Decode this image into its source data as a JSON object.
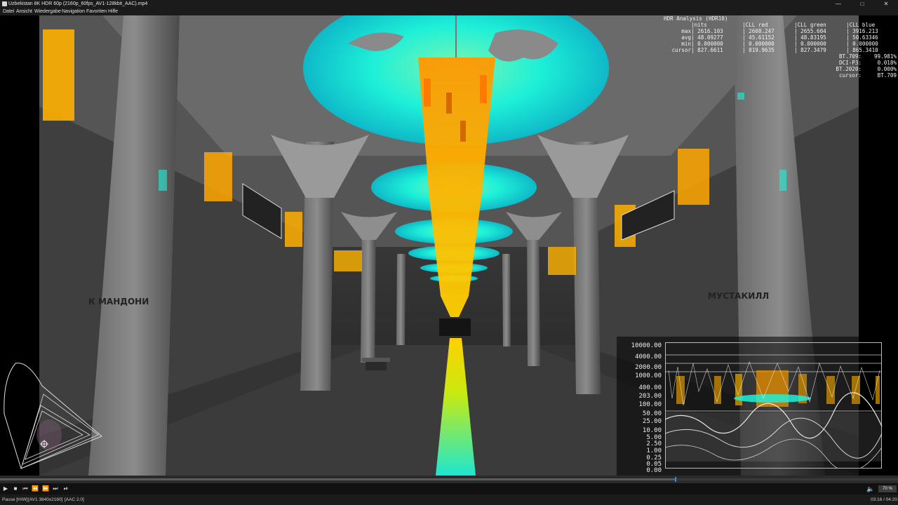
{
  "window": {
    "title": "Uzbekistan 8K HDR 60p (2160p_60fps_AV1-128kbit_AAC).mp4",
    "controls": [
      "—",
      "□",
      "✕"
    ]
  },
  "menu": [
    "Datei",
    "Ansicht",
    "Wiedergabe",
    "Navigation",
    "Favoriten",
    "Hilfe"
  ],
  "hdr_analysis": {
    "title": "HDR Analysis (HDR10)",
    "columns": [
      "nits",
      "CLL red",
      "CLL green",
      "CLL blue"
    ],
    "rows": [
      {
        "label": "max",
        "values": [
          "2616.103",
          "2608.247",
          "2655.604",
          "3916.213"
        ]
      },
      {
        "label": "avg",
        "values": [
          "48.09277",
          "45.61152",
          "48.83195",
          "50.63346"
        ]
      },
      {
        "label": "min",
        "values": [
          "0.000000",
          "0.000000",
          "0.000000",
          "0.000000"
        ]
      },
      {
        "label": "cursor",
        "values": [
          "827.6611",
          "819.9635",
          "827.3479",
          "865.3410"
        ]
      }
    ],
    "gamut": [
      {
        "label": "BT.709:",
        "value": "99.981%"
      },
      {
        "label": "DCI-P3:",
        "value": "0.018%"
      },
      {
        "label": "BT.2020:",
        "value": "0.000%"
      },
      {
        "label": "cursor:",
        "value": "BT.709"
      }
    ]
  },
  "histogram": {
    "scale_labels": [
      "10000.00",
      "4000.00",
      "2000.00",
      "1000.00",
      "400.00",
      "203.00",
      "100.00",
      "50.00",
      "25.00",
      "10.00",
      "5.00",
      "2.50",
      "1.00",
      "0.25",
      "0.05",
      "0.00"
    ]
  },
  "station_signs": {
    "left": "К МАНДОНИ",
    "right": "МУСТАКИЛЛ"
  },
  "playback": {
    "progress": 0.752,
    "buttons": [
      "play-icon",
      "stop-icon",
      "skip-back-icon",
      "rewind-icon",
      "fast-forward-icon",
      "skip-forward-icon",
      "frame-step-icon"
    ],
    "zoom": "70 %"
  },
  "status": {
    "state": "Pause [H/W]",
    "video": "[AV1 3840x2160]",
    "audio": "[AAC 2.0]",
    "time": "03:16 / 04:20"
  },
  "colors": {
    "accent": "#2d8cff",
    "hdr_cyan": "#19f0d6",
    "hdr_orange": "#ff8a00",
    "hdr_yellow": "#f2e600"
  }
}
